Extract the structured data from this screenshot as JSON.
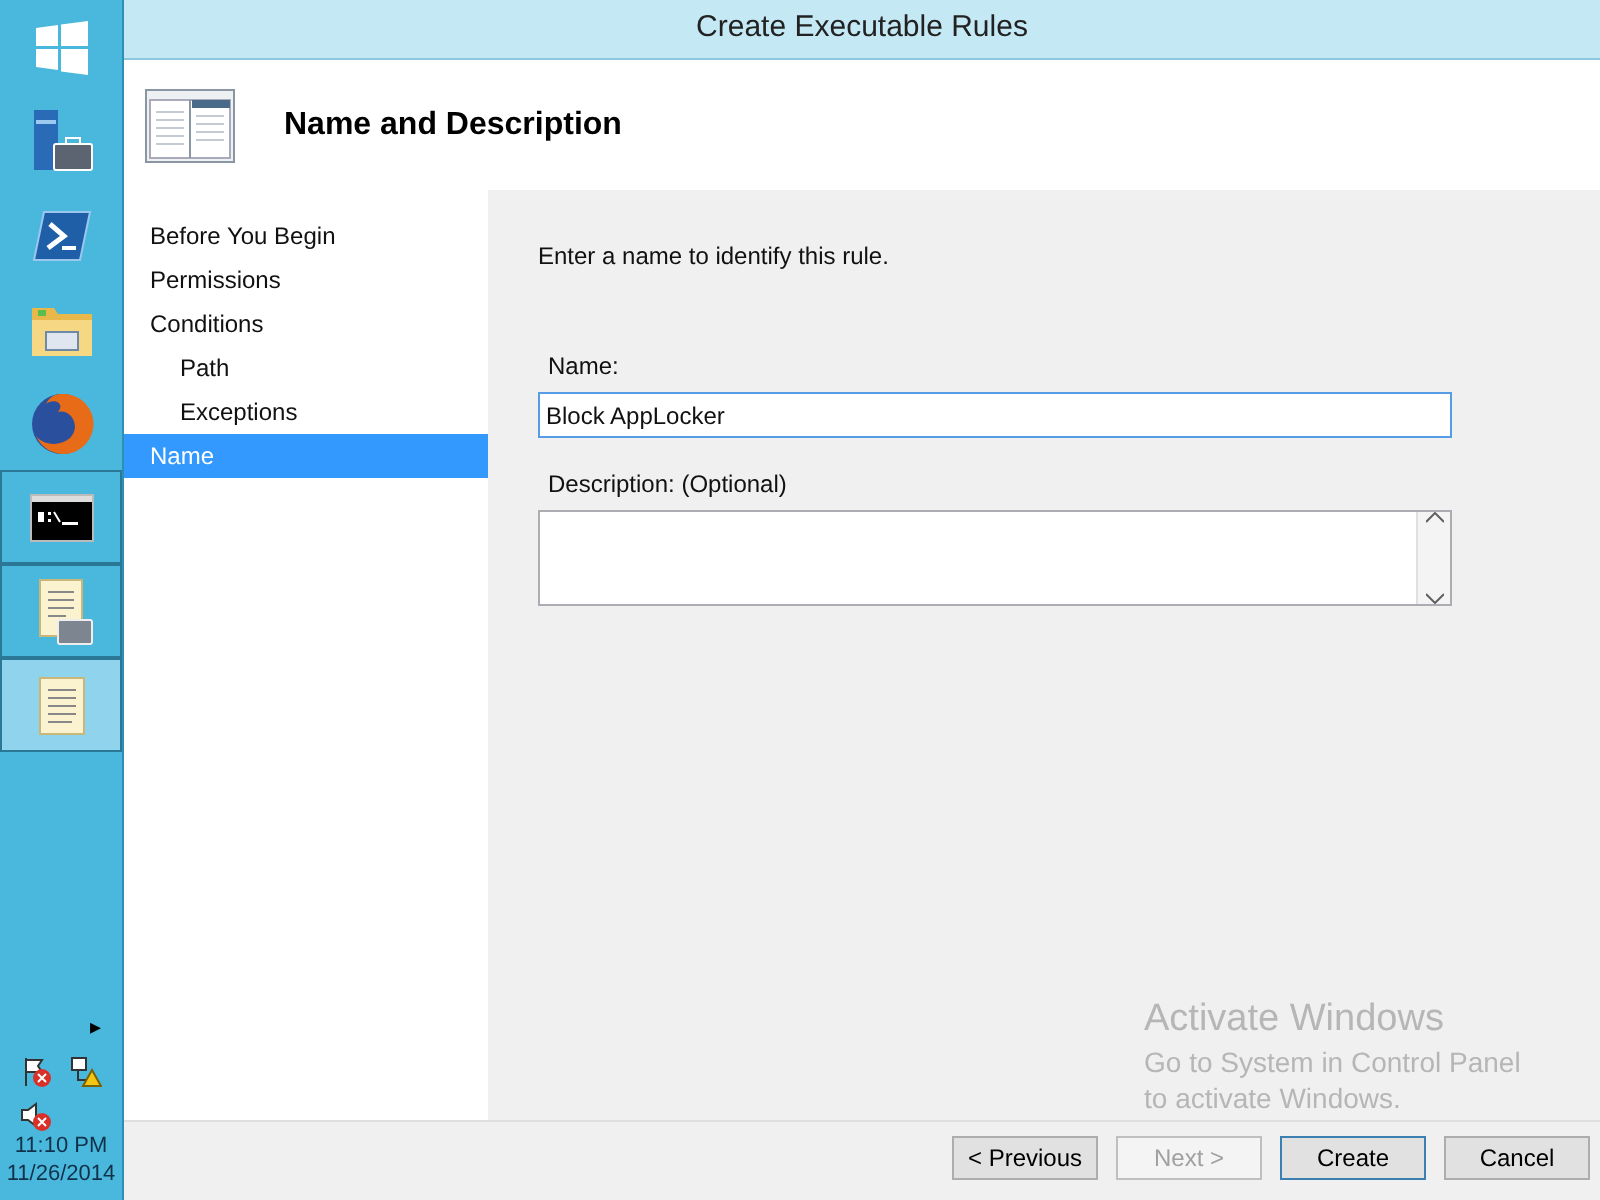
{
  "taskbar": {
    "apps": [
      {
        "kind": "start",
        "running": false,
        "selected": false
      },
      {
        "kind": "server",
        "running": false,
        "selected": false
      },
      {
        "kind": "shell",
        "running": false,
        "selected": false
      },
      {
        "kind": "folder",
        "running": false,
        "selected": false
      },
      {
        "kind": "browser",
        "running": false,
        "selected": false
      },
      {
        "kind": "console",
        "running": true,
        "selected": false
      },
      {
        "kind": "scroll-tools",
        "running": true,
        "selected": false
      },
      {
        "kind": "scroll",
        "running": true,
        "selected": true
      }
    ],
    "tray_arrow": "▸",
    "time": "11:10 PM",
    "date": "11/26/2014"
  },
  "window": {
    "title": "Create Executable Rules"
  },
  "header": {
    "title": "Name and Description"
  },
  "steps": [
    {
      "label": "Before You Begin",
      "selected": false
    },
    {
      "label": "Permissions",
      "selected": false
    },
    {
      "label": "Conditions",
      "selected": false,
      "children": [
        {
          "label": "Path",
          "selected": false
        },
        {
          "label": "Exceptions",
          "selected": false
        }
      ]
    },
    {
      "label": "Name",
      "selected": true
    }
  ],
  "content": {
    "instruction": "Enter a name to identify this rule.",
    "name_label": "Name:",
    "name_value": "Block AppLocker",
    "description_label": "Description: (Optional)"
  },
  "buttons": [
    {
      "label": "< Previous",
      "disabled": false,
      "default": false
    },
    {
      "label": "Next >",
      "disabled": true,
      "default": false
    },
    {
      "label": "Create",
      "disabled": false,
      "default": true
    },
    {
      "label": "Cancel",
      "disabled": false,
      "default": false
    }
  ],
  "activation": {
    "title": "Activate Windows",
    "lines": [
      "Go to System in Control Panel",
      "to activate Windows."
    ]
  }
}
